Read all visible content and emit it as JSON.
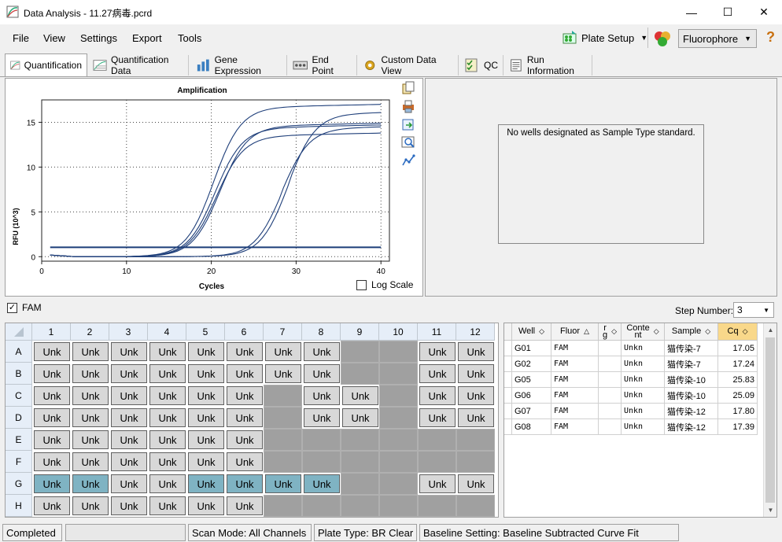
{
  "window": {
    "title": "Data Analysis - 11.27病毒.pcrd",
    "minimize": "—",
    "maximize": "☐",
    "close": "✕"
  },
  "menu": [
    "File",
    "View",
    "Settings",
    "Export",
    "Tools"
  ],
  "toolbar": {
    "plate_setup": "Plate Setup",
    "fluorophore": "Fluorophore",
    "help": "?"
  },
  "tabs": [
    {
      "label": "Quantification",
      "active": true
    },
    {
      "label": "Quantification Data"
    },
    {
      "label": "Gene Expression"
    },
    {
      "label": "End Point"
    },
    {
      "label": "Custom Data View"
    },
    {
      "label": "QC"
    },
    {
      "label": "Run Information"
    }
  ],
  "chart_panel": {
    "log_scale_label": "Log Scale"
  },
  "std_panel": {
    "message": "No wells designated as Sample Type standard."
  },
  "fluor_check": {
    "label": "FAM",
    "checked": true
  },
  "step": {
    "label": "Step Number:",
    "value": "3"
  },
  "plate": {
    "columns": [
      "1",
      "2",
      "3",
      "4",
      "5",
      "6",
      "7",
      "8",
      "9",
      "10",
      "11",
      "12"
    ],
    "rows": [
      "A",
      "B",
      "C",
      "D",
      "E",
      "F",
      "G",
      "H"
    ],
    "cell_label": "Unk",
    "filled": {
      "A": [
        1,
        2,
        3,
        4,
        5,
        6,
        7,
        8,
        11,
        12
      ],
      "B": [
        1,
        2,
        3,
        4,
        5,
        6,
        7,
        8,
        11,
        12
      ],
      "C": [
        1,
        2,
        3,
        4,
        5,
        6,
        8,
        9,
        11,
        12
      ],
      "D": [
        1,
        2,
        3,
        4,
        5,
        6,
        8,
        9,
        11,
        12
      ],
      "E": [
        1,
        2,
        3,
        4,
        5,
        6
      ],
      "F": [
        1,
        2,
        3,
        4,
        5,
        6
      ],
      "G": [
        1,
        2,
        3,
        4,
        5,
        6,
        7,
        8,
        11,
        12
      ],
      "H": [
        1,
        2,
        3,
        4,
        5,
        6
      ]
    },
    "selected": {
      "G": [
        1,
        2,
        5,
        6,
        7,
        8
      ]
    }
  },
  "table": {
    "headers": [
      "Well",
      "Fluor",
      "r\ng",
      "Conte\nnt",
      "Sample",
      "Cq"
    ],
    "rows": [
      {
        "well": "G01",
        "fluor": "FAM",
        "content": "Unkn",
        "sample": "猫传染-7",
        "cq": "17.05"
      },
      {
        "well": "G02",
        "fluor": "FAM",
        "content": "Unkn",
        "sample": "猫传染-7",
        "cq": "17.24"
      },
      {
        "well": "G05",
        "fluor": "FAM",
        "content": "Unkn",
        "sample": "猫传染-10",
        "cq": "25.83"
      },
      {
        "well": "G06",
        "fluor": "FAM",
        "content": "Unkn",
        "sample": "猫传染-10",
        "cq": "25.09"
      },
      {
        "well": "G07",
        "fluor": "FAM",
        "content": "Unkn",
        "sample": "猫传染-12",
        "cq": "17.80"
      },
      {
        "well": "G08",
        "fluor": "FAM",
        "content": "Unkn",
        "sample": "猫传染-12",
        "cq": "17.39"
      }
    ]
  },
  "status": {
    "state": "Completed",
    "scan_mode": "Scan Mode: All Channels",
    "plate_type": "Plate Type: BR Clear",
    "baseline": "Baseline Setting: Baseline Subtracted Curve Fit"
  },
  "colors": {
    "curve": "#1f3f7a",
    "threshold": "#1b3d78",
    "selected_well": "#7fb3c3",
    "cq_header": "#f9d88a"
  },
  "chart_data": {
    "type": "line",
    "title": "Amplification",
    "xlabel": "Cycles",
    "ylabel": "RFU (10^3)",
    "xlim": [
      0,
      41
    ],
    "ylim": [
      -0.5,
      17.5
    ],
    "xticks": [
      0,
      10,
      20,
      30,
      40
    ],
    "yticks": [
      0,
      5,
      10,
      15
    ],
    "grid": true,
    "threshold": 1.05,
    "series": [
      {
        "cq": 17.05,
        "plateau": 16.6
      },
      {
        "cq": 17.24,
        "plateau": 14.3
      },
      {
        "cq": 17.8,
        "plateau": 14.5
      },
      {
        "cq": 17.39,
        "plateau": 13.4
      },
      {
        "cq": 25.83,
        "plateau": 15.7
      },
      {
        "cq": 25.09,
        "plateau": 14.1
      }
    ]
  }
}
